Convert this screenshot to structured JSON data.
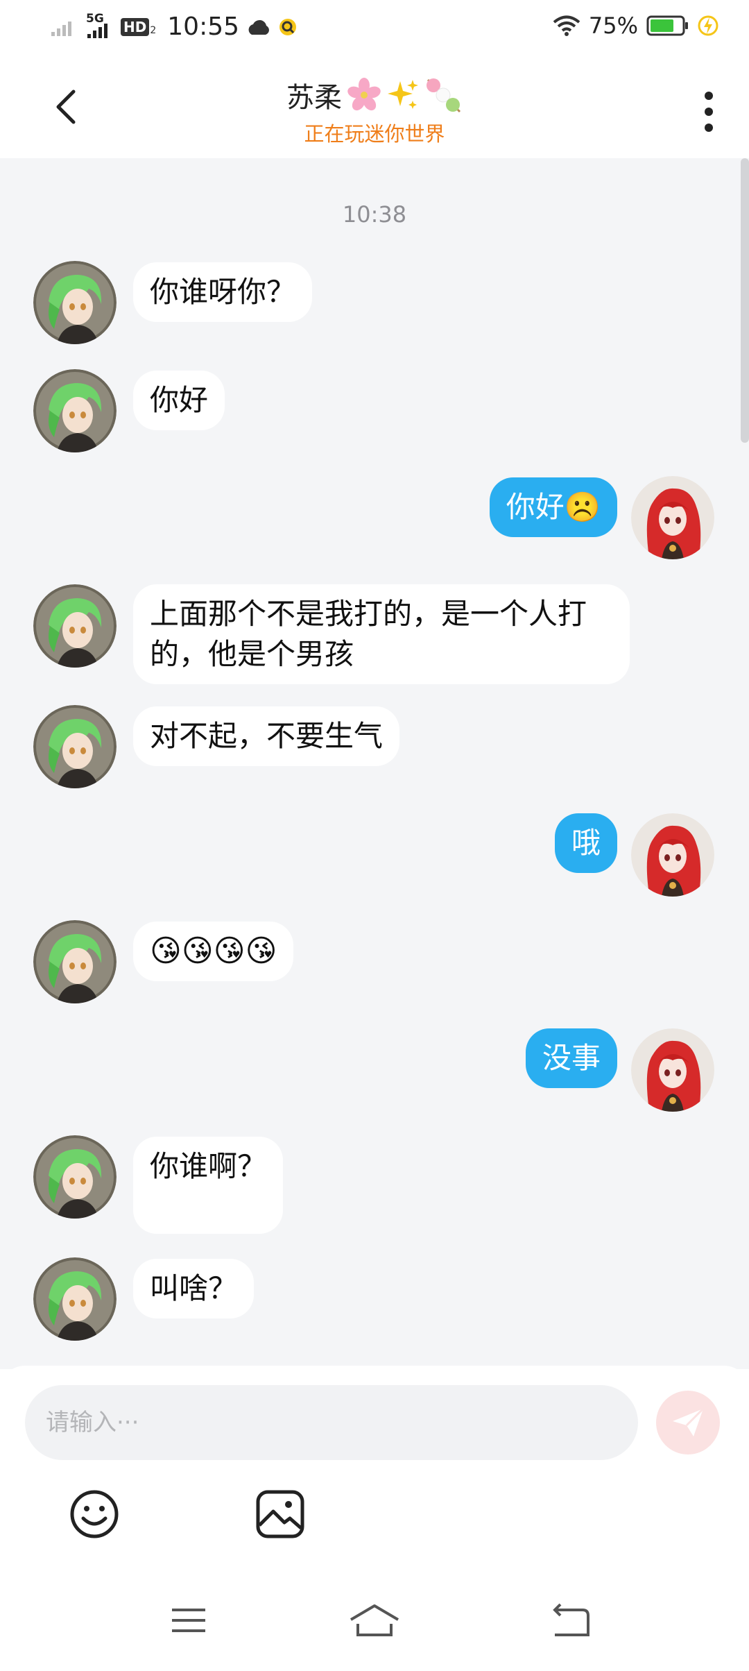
{
  "status_bar": {
    "network": "5G",
    "hd": "HD",
    "time": "10:55",
    "battery_percent": "75%",
    "battery_level": 0.75
  },
  "header": {
    "name": "苏柔",
    "status": "正在玩迷你世界",
    "name_emoji_icons": [
      "cherry-blossom-icon",
      "sparkles-icon",
      "dango-icon"
    ]
  },
  "chat": {
    "time_divider": "10:38",
    "messages": [
      {
        "side": "left",
        "text": "你谁呀你？"
      },
      {
        "side": "left",
        "text": "你好"
      },
      {
        "side": "right",
        "text": "你好☹️"
      },
      {
        "side": "left",
        "text": "上面那个不是我打的，是一个人打的，他是个男孩"
      },
      {
        "side": "left",
        "text": "对不起，不要生气"
      },
      {
        "side": "right",
        "text": "哦"
      },
      {
        "side": "left",
        "text": "😘😘😘😘"
      },
      {
        "side": "right",
        "text": "没事"
      },
      {
        "side": "left",
        "text": "你谁啊？"
      },
      {
        "side": "left",
        "text": "叫啥？"
      }
    ]
  },
  "input": {
    "placeholder": "请输入···"
  },
  "colors": {
    "accent_blue": "#2aaef0",
    "status_orange": "#ef7e1a",
    "chat_bg": "#f4f5f7",
    "send_button_bg": "#fbe2e2"
  }
}
